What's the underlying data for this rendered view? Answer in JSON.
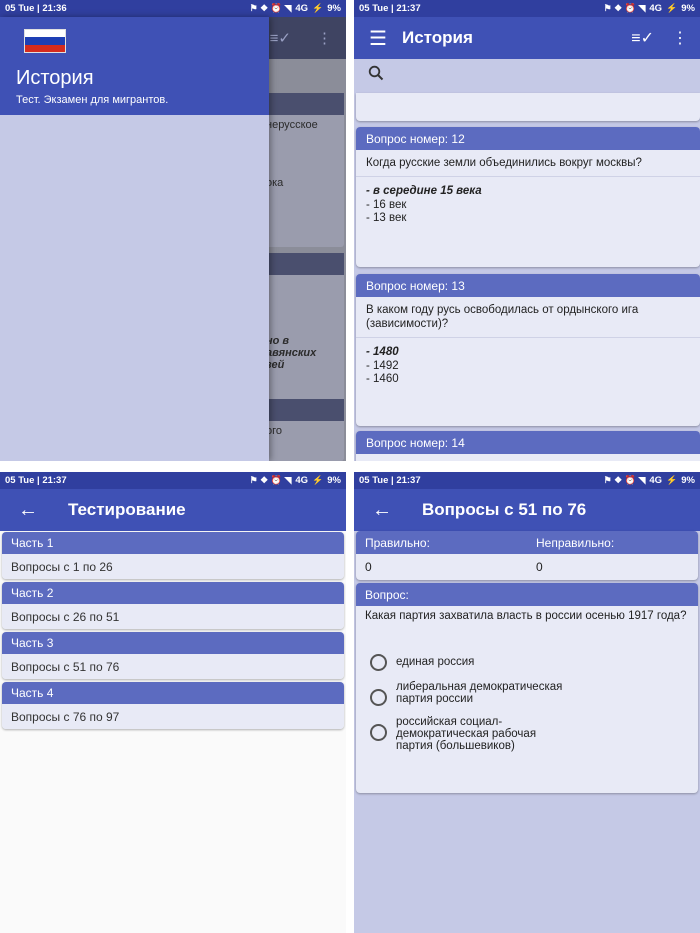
{
  "status": {
    "p1_time": "05 Tue | 21:36",
    "p2_time": "05 Tue | 21:37",
    "p3_time": "05 Tue | 21:37",
    "p4_time": "05 Tue | 21:37",
    "network": "4G",
    "battery": "9%"
  },
  "drawer": {
    "title": "История",
    "subtitle": "Тест. Экзамен для мигрантов.",
    "flag_colors": [
      "#ffffff",
      "#1e3fb5",
      "#d52b1e"
    ]
  },
  "behind": {
    "snippets": [
      "нерусское",
      "ока",
      "но в",
      "авянских",
      "зей",
      "ого"
    ]
  },
  "history": {
    "title": "История",
    "questions": [
      {
        "header": "Вопрос номер: 12",
        "text": "Когда русские земли объединились вокруг москвы?",
        "answers": [
          "- в середине 15 века",
          "- 16 век",
          "- 13 век"
        ]
      },
      {
        "header": "Вопрос номер: 13",
        "text": "В каком году русь освободилась от ордынского ига (зависимости)?",
        "answers": [
          "- 1480",
          "- 1492",
          "- 1460"
        ]
      },
      {
        "header": "Вопрос номер: 14"
      }
    ]
  },
  "testing": {
    "title": "Тестирование",
    "parts": [
      {
        "header": "Часть 1",
        "range": "Вопросы с 1 по 26"
      },
      {
        "header": "Часть 2",
        "range": "Вопросы с 26 по 51"
      },
      {
        "header": "Часть 3",
        "range": "Вопросы с 51 по 76"
      },
      {
        "header": "Часть 4",
        "range": "Вопросы с 76 по 97"
      }
    ]
  },
  "quiz": {
    "title": "Вопросы с 51 по 76",
    "correct_label": "Правильно:",
    "wrong_label": "Неправильно:",
    "correct_count": "0",
    "wrong_count": "0",
    "question_label": "Вопрос:",
    "question": "Какая партия захватила власть в россии осенью 1917 года?",
    "options": [
      "единая россия",
      "либеральная демократическая партия россии",
      "российская социал-демократическая рабочая партия (большевиков)"
    ]
  },
  "colors": {
    "primary": "#3f51b5",
    "primary_dark": "#303f9f",
    "card_header": "#5c6bc0",
    "card_body": "#e8eaf6",
    "background": "#c5c9e6"
  }
}
